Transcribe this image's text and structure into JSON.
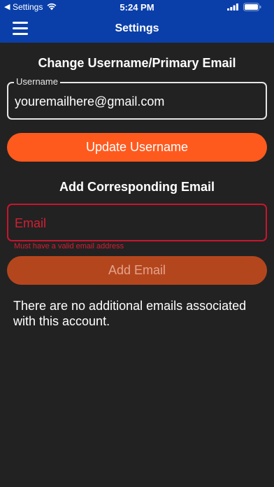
{
  "status_bar": {
    "back_glyph": "◀",
    "carrier": "Settings",
    "time": "5:24 PM"
  },
  "nav": {
    "title": "Settings"
  },
  "username_section": {
    "heading": "Change Username/Primary Email",
    "field_label": "Username",
    "field_value": "youremailhere@gmail.com",
    "button_label": "Update Username"
  },
  "email_section": {
    "heading": "Add Corresponding Email",
    "field_placeholder": "Email",
    "error_text": "Must have a valid email address",
    "button_label": "Add Email",
    "empty_message": "There are no additional emails associated with this account."
  },
  "colors": {
    "nav_background": "#0a3faa",
    "page_background": "#222222",
    "primary_button": "#ff5a1e",
    "disabled_button": "#b4461e",
    "error": "#d21f33"
  }
}
